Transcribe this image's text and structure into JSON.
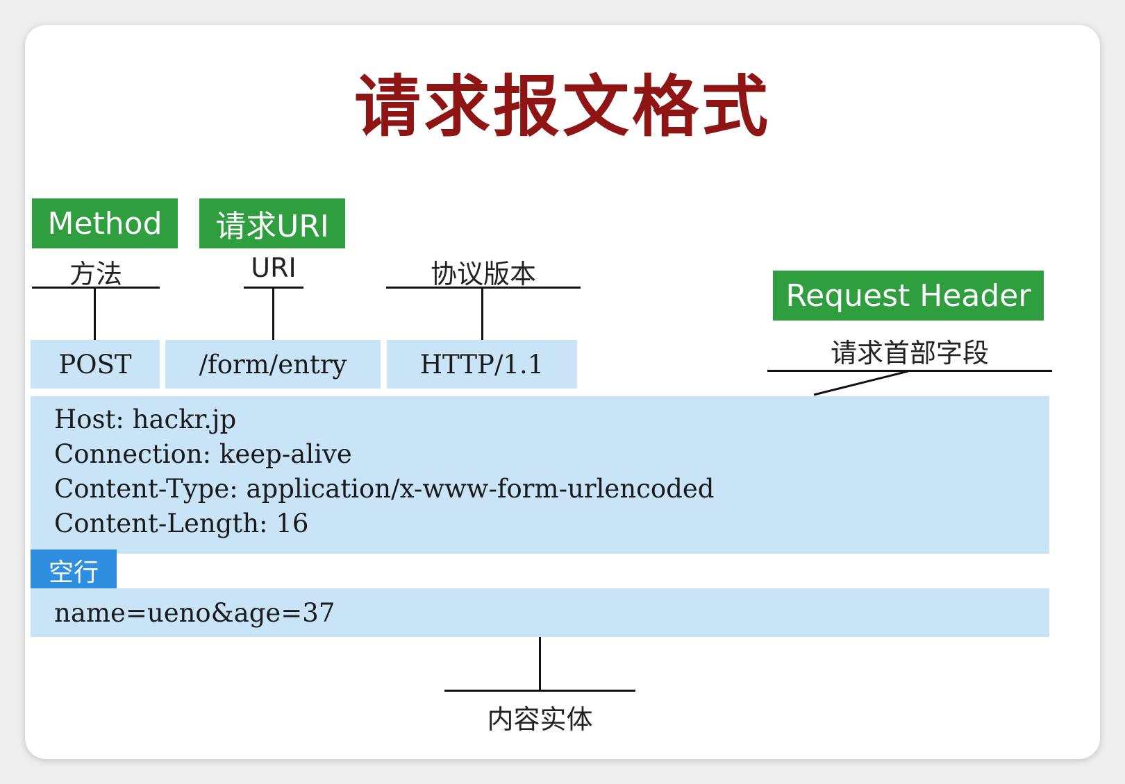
{
  "title": "请求报文格式",
  "tags": {
    "method": "Method",
    "request_uri": "请求URI",
    "request_header": "Request Header",
    "blank_line": "空行"
  },
  "labels": {
    "method": "方法",
    "uri": "URI",
    "protocol_version": "协议版本",
    "header_fields": "请求首部字段",
    "body": "内容实体"
  },
  "request_line": {
    "method": "POST",
    "uri": "/form/entry",
    "version": "HTTP/1.1"
  },
  "headers": [
    "Host: hackr.jp",
    "Connection: keep-alive",
    "Content-Type: application/x-www-form-urlencoded",
    "Content-Length: 16"
  ],
  "body": "name=ueno&age=37",
  "colors": {
    "title": "#8f1515",
    "tag_green": "#2e9e3e",
    "tag_blue": "#2f8ee0",
    "box_fill": "#c8e4f6"
  }
}
